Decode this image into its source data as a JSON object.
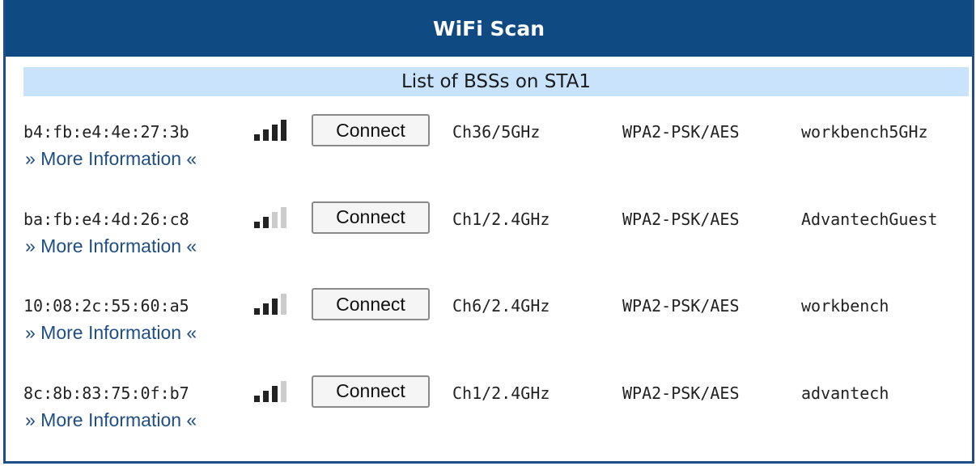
{
  "panel": {
    "title": "WiFi Scan",
    "subtitle": "List of BSSs on STA1"
  },
  "colors": {
    "header_bg": "#0f4a82",
    "subheader_bg": "#c8e3fb",
    "signal_on": "#222222",
    "signal_off": "#cccccc",
    "link": "#1f4e86"
  },
  "networks": [
    {
      "bssid": "b4:fb:e4:4e:27:3b",
      "signal_bars": 4,
      "signal_max": 4,
      "connect_label": "Connect",
      "channel": "Ch36/5GHz",
      "security": "WPA2-PSK/AES",
      "ssid": "workbench5GHz",
      "more_info": "» More Information «"
    },
    {
      "bssid": "ba:fb:e4:4d:26:c8",
      "signal_bars": 2,
      "signal_max": 4,
      "connect_label": "Connect",
      "channel": "Ch1/2.4GHz",
      "security": "WPA2-PSK/AES",
      "ssid": "AdvantechGuest",
      "more_info": "» More Information «"
    },
    {
      "bssid": "10:08:2c:55:60:a5",
      "signal_bars": 3,
      "signal_max": 4,
      "connect_label": "Connect",
      "channel": "Ch6/2.4GHz",
      "security": "WPA2-PSK/AES",
      "ssid": "workbench",
      "more_info": "» More Information «"
    },
    {
      "bssid": "8c:8b:83:75:0f:b7",
      "signal_bars": 3,
      "signal_max": 4,
      "connect_label": "Connect",
      "channel": "Ch1/2.4GHz",
      "security": "WPA2-PSK/AES",
      "ssid": "advantech",
      "more_info": "» More Information «"
    }
  ]
}
